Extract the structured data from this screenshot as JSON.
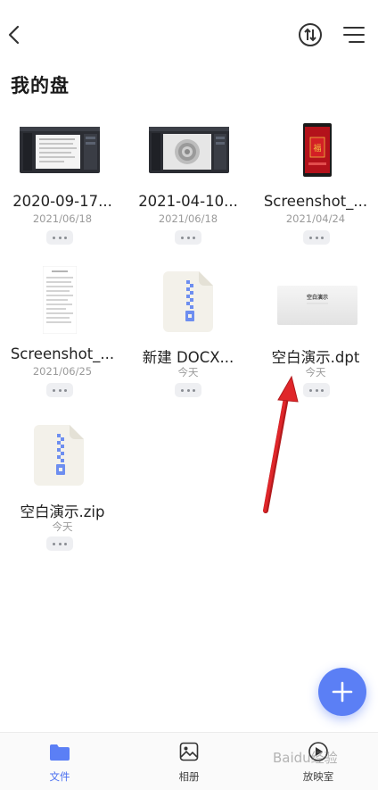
{
  "header": {
    "title": "我的盘",
    "icons": {
      "back": "chevron-left-icon",
      "sort": "sort-arrows-icon",
      "menu": "list-menu-icon"
    }
  },
  "files": [
    {
      "name": "2020-09-17...",
      "date": "2021/06/18",
      "thumb": "screenshot-dark-app"
    },
    {
      "name": "2021-04-10...",
      "date": "2021/06/18",
      "thumb": "screenshot-dark-app"
    },
    {
      "name": "Screenshot_...",
      "date": "2021/04/24",
      "thumb": "screenshot-red-phone"
    },
    {
      "name": "Screenshot_...",
      "date": "2021/06/25",
      "thumb": "screenshot-text-doc"
    },
    {
      "name": "新建 DOCX...",
      "date": "今天",
      "thumb": "zip-archive-icon"
    },
    {
      "name": "空白演示.dpt",
      "date": "今天",
      "thumb": "presentation-slide"
    },
    {
      "name": "空白演示.zip",
      "date": "今天",
      "thumb": "zip-archive-icon"
    }
  ],
  "slide_thumb_text": "空白演示",
  "fab": {
    "icon": "plus-icon"
  },
  "bottom_nav": [
    {
      "label": "文件",
      "icon": "folder-icon",
      "active": true
    },
    {
      "label": "相册",
      "icon": "photo-album-icon",
      "active": false
    },
    {
      "label": "放映室",
      "icon": "projector-icon",
      "active": false
    }
  ],
  "colors": {
    "accent": "#5b7ff5",
    "arrow": "#e0262a"
  },
  "watermark": "Baidu经验"
}
